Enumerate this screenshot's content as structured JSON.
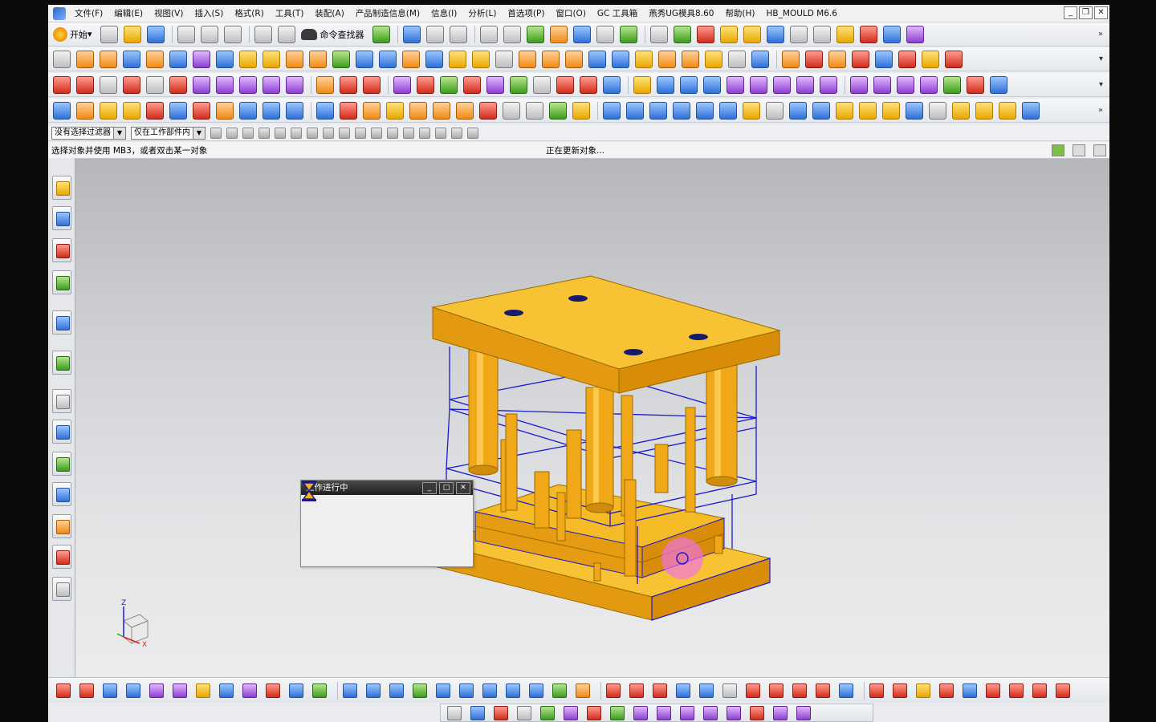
{
  "menu": {
    "items": [
      "文件(F)",
      "编辑(E)",
      "视图(V)",
      "插入(S)",
      "格式(R)",
      "工具(T)",
      "装配(A)",
      "产品制造信息(M)",
      "信息(I)",
      "分析(L)",
      "首选项(P)",
      "窗口(O)",
      "GC 工具箱",
      "燕秀UG模具8.60",
      "帮助(H)",
      "HB_MOULD M6.6"
    ],
    "window_buttons": [
      "_",
      "❐",
      "✕"
    ]
  },
  "toolbar1": {
    "start_label": "开始",
    "command_finder_label": "命令查找器"
  },
  "filter": {
    "type_filter": "没有选择过滤器",
    "scope_filter": "仅在工作部件内"
  },
  "status": {
    "prompt": "选择对象并使用 MB3，或者双击某一对象",
    "message": "正在更新对象..."
  },
  "dialog": {
    "title": "工作进行中",
    "buttons": [
      "_",
      "□",
      "✕"
    ]
  },
  "triad": {
    "z_label": "Z",
    "x_label": "X"
  },
  "colors": {
    "mold_yellow": "#f4b21d",
    "wire_blue": "#1a1ad0",
    "highlight_magenta": "#f070f0",
    "dialog_title_bg": "#2a2a2a"
  }
}
